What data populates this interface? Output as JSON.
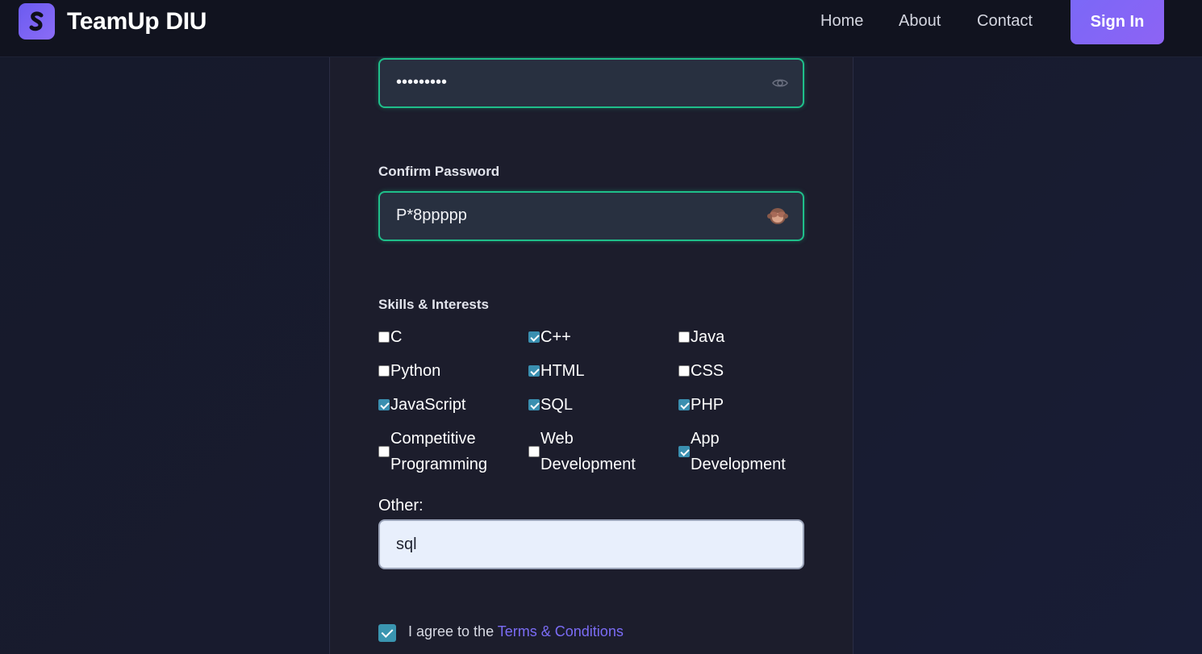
{
  "nav": {
    "brand": "TeamUp DIU",
    "links": [
      "Home",
      "About",
      "Contact"
    ],
    "signin": "Sign In"
  },
  "form": {
    "password_value": "•••••••••",
    "confirm_label": "Confirm Password",
    "confirm_value": "P*8ppppp",
    "skills_label": "Skills & Interests",
    "skills": [
      {
        "label": "C",
        "checked": false
      },
      {
        "label": "C++",
        "checked": true
      },
      {
        "label": "Java",
        "checked": false
      },
      {
        "label": "Python",
        "checked": false
      },
      {
        "label": "HTML",
        "checked": true
      },
      {
        "label": "CSS",
        "checked": false
      },
      {
        "label": "JavaScript",
        "checked": true
      },
      {
        "label": "SQL",
        "checked": true
      },
      {
        "label": "PHP",
        "checked": true
      },
      {
        "label": "Competitive Programming",
        "line1": "Competitive",
        "line2": "Programming",
        "checked": false
      },
      {
        "label": "Web Development",
        "line1": "Web",
        "line2": "Development",
        "checked": false
      },
      {
        "label": "App Development",
        "line1": "App",
        "line2": "Development",
        "checked": true
      }
    ],
    "other_label": "Other:",
    "other_value": "sql",
    "agree_prefix": "I agree to the ",
    "agree_link": "Terms & Conditions",
    "agree_checked": true
  },
  "colors": {
    "accent": "#7b68f7",
    "field_border": "#1fbf8a",
    "checkbox": "#3a8fb0"
  },
  "icons": {
    "password_toggle": "eye-icon",
    "confirm_toggle": "see-no-evil-monkey-icon",
    "logo": "s-logo-icon"
  }
}
